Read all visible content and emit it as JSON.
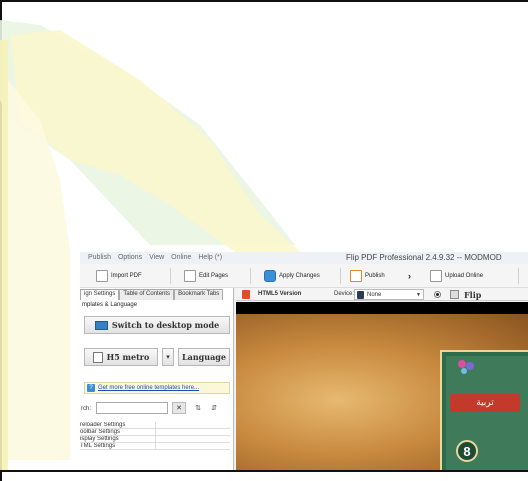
{
  "window": {
    "title": "Flip PDF Professional 2.4.9.32 -- MODMOD",
    "menu": [
      "Publish",
      "Options",
      "View",
      "Online",
      "Help (*)"
    ]
  },
  "toolbar": {
    "import_pdf": "Import PDF",
    "edit_pages": "Edit Pages",
    "apply_changes": "Apply Changes",
    "publish": "Publish",
    "upload_online": "Upload Online"
  },
  "left_panel": {
    "tabs": [
      "ign Settings",
      "Table of Contents",
      "Bookmark Tabs"
    ],
    "group_label": "mplates & Language",
    "switch_button": "Switch to desktop mode",
    "template_button": "H5 metro",
    "language_button": "Language",
    "more_templates_link": "Get more free online templates here...",
    "search_label": "rch:",
    "search_value": "",
    "settings_rows": [
      "reloader Settings",
      "oolbar Settings",
      "isplay Settings",
      "TML Settings"
    ]
  },
  "preview_bar": {
    "version_label": "HTML5 Version",
    "device_label": "Device:",
    "device_value": "None",
    "view_label": "Flip"
  },
  "book": {
    "cover_title": "تربية",
    "cover_number": "8"
  },
  "colors": {
    "watermark_green": "#2ea043",
    "watermark_yellow": "#f4ea4a",
    "book_bg": "#c88a3f",
    "cover_green": "#2e6b4a"
  }
}
